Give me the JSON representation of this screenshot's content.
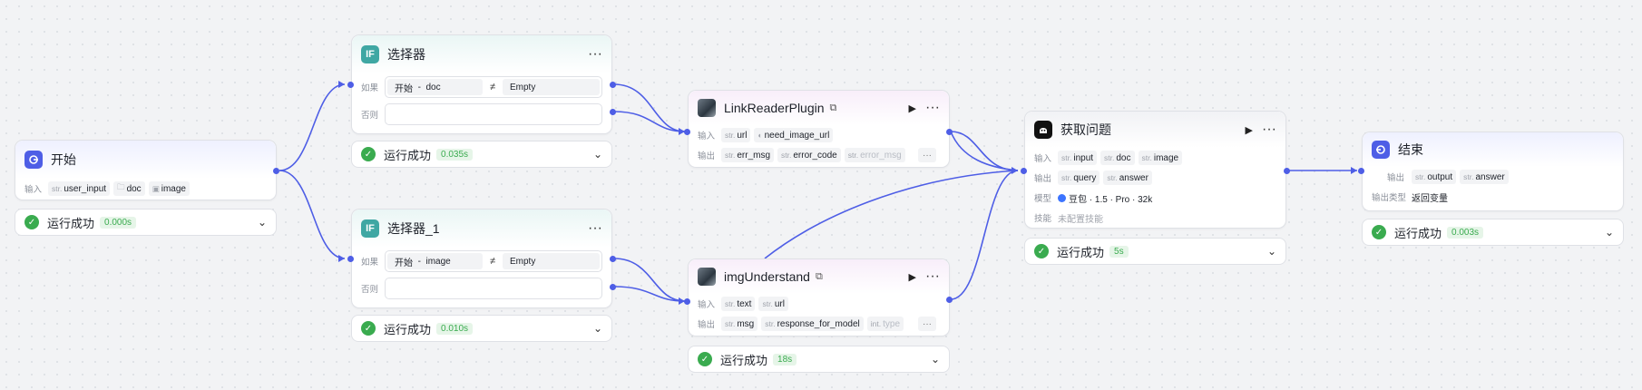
{
  "nodes": {
    "start": {
      "title": "开始",
      "input_label": "输入",
      "inputs": [
        {
          "type": "str.",
          "name": "user_input"
        },
        {
          "type": "folder",
          "name": "doc"
        },
        {
          "type": "image",
          "name": "image"
        }
      ]
    },
    "selector": {
      "title": "选择器",
      "if_label": "如果",
      "else_label": "否则",
      "condition": {
        "left_node": "开始",
        "separator": "-",
        "left_var": "doc",
        "operator": "≠",
        "right": "Empty"
      }
    },
    "selector_1": {
      "title": "选择器_1",
      "if_label": "如果",
      "else_label": "否则",
      "condition": {
        "left_node": "开始",
        "separator": "-",
        "left_var": "image",
        "operator": "≠",
        "right": "Empty"
      }
    },
    "link_reader": {
      "title": "LinkReaderPlugin",
      "input_label": "输入",
      "output_label": "输出",
      "inputs": [
        {
          "type": "str.",
          "name": "url"
        },
        {
          "type": "bool",
          "name": "need_image_url"
        }
      ],
      "outputs": [
        {
          "type": "str.",
          "name": "err_msg"
        },
        {
          "type": "str.",
          "name": "error_code"
        },
        {
          "type": "str.",
          "name": "error_msg"
        }
      ]
    },
    "img_understand": {
      "title": "imgUnderstand",
      "input_label": "输入",
      "output_label": "输出",
      "inputs": [
        {
          "type": "str.",
          "name": "text"
        },
        {
          "type": "str.",
          "name": "url"
        }
      ],
      "outputs": [
        {
          "type": "str.",
          "name": "msg"
        },
        {
          "type": "str.",
          "name": "response_for_model"
        },
        {
          "type": "int.",
          "name": "type"
        }
      ]
    },
    "get_question": {
      "title": "获取问题",
      "input_label": "输入",
      "output_label": "输出",
      "model_label": "模型",
      "skill_label": "技能",
      "inputs": [
        {
          "type": "str.",
          "name": "input"
        },
        {
          "type": "str.",
          "name": "doc"
        },
        {
          "type": "str.",
          "name": "image"
        }
      ],
      "outputs": [
        {
          "type": "str.",
          "name": "query"
        },
        {
          "type": "str.",
          "name": "answer"
        }
      ],
      "model": "豆包 · 1.5 · Pro · 32k",
      "skill": "未配置技能"
    },
    "end": {
      "title": "结束",
      "output_label": "输出",
      "output_type_label": "输出类型",
      "outputs": [
        {
          "type": "str.",
          "name": "output"
        },
        {
          "type": "str.",
          "name": "answer"
        }
      ],
      "output_type": "返回变量"
    }
  },
  "statuses": {
    "start": {
      "text": "运行成功",
      "duration": "0.000s"
    },
    "selector": {
      "text": "运行成功",
      "duration": "0.035s"
    },
    "selector_1": {
      "text": "运行成功",
      "duration": "0.010s"
    },
    "img_understand": {
      "text": "运行成功",
      "duration": "18s"
    },
    "get_question": {
      "text": "运行成功",
      "duration": "5s"
    },
    "end": {
      "text": "运行成功",
      "duration": "0.003s"
    }
  },
  "icons": {
    "more": "more-dots-icon",
    "run": "play-icon",
    "expand": "chevron-down-icon",
    "success": "check-circle-icon",
    "plugin": "plugin-icon"
  },
  "colors": {
    "accent": "#4e5ee6",
    "success": "#3aab4f",
    "edge": "#4e5ee6"
  }
}
